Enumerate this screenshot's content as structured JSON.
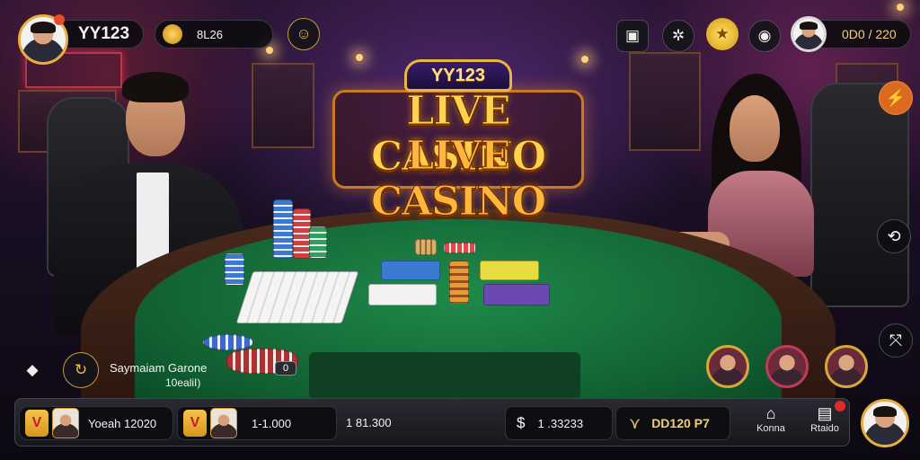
{
  "top_bar": {
    "player_name": "YY123",
    "balance": "8L26",
    "right_counter": "0D0 / 220"
  },
  "logo": {
    "brand": "YY123",
    "line1": "LIVE CASINO",
    "line2": "LIVE CASINO"
  },
  "dealer_info": {
    "name": "Saymaiam Garone",
    "sub": "10ealiI)",
    "chip_value": "0"
  },
  "bottom_bar": {
    "slot1_text": "Yoeah 12020",
    "slot2_text": "1-1.000",
    "slot3_text": "1 81.300",
    "slot4_text": "1 .33233",
    "slot5_text": "DD120 P7",
    "btn_home_label": "Konna",
    "btn_stats_label": "Rtaido",
    "v_badge": "V"
  },
  "colors": {
    "gold": "#e8b040",
    "felt": "#1f8a4a",
    "logo_gold": "#ffd34d"
  },
  "icons": {
    "top": [
      "crown-icon",
      "coin-icon",
      "mask-icon",
      "screen-icon",
      "settings-gear-icon",
      "star-badge-icon",
      "record-icon"
    ],
    "side": [
      "lightning-icon",
      "swap-icon",
      "expand-icon"
    ],
    "bottom": [
      "dollar-icon",
      "chevron-icon",
      "home-icon",
      "stats-icon"
    ]
  }
}
